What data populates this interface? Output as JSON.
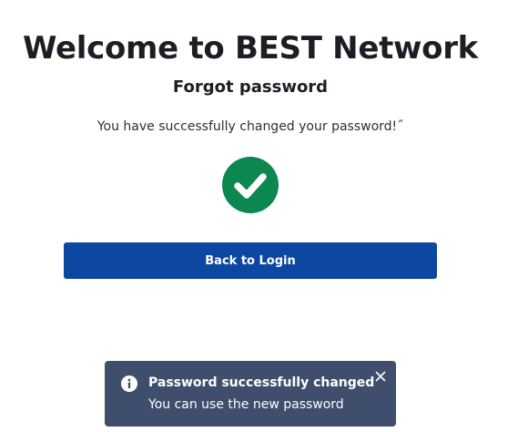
{
  "header": {
    "title": "Welcome to BEST Network",
    "subtitle": "Forgot password"
  },
  "main": {
    "message": "You have successfully changed your password!˝",
    "status_icon": "check-circle-icon",
    "back_button_label": "Back to Login"
  },
  "toast": {
    "icon": "info-icon",
    "title": "Password successfully changed",
    "text": "You can use the new password",
    "close_icon": "close-icon"
  },
  "colors": {
    "success": "#0b874f",
    "primary_button": "#0c47a1",
    "toast_background": "#3f4e6c"
  }
}
